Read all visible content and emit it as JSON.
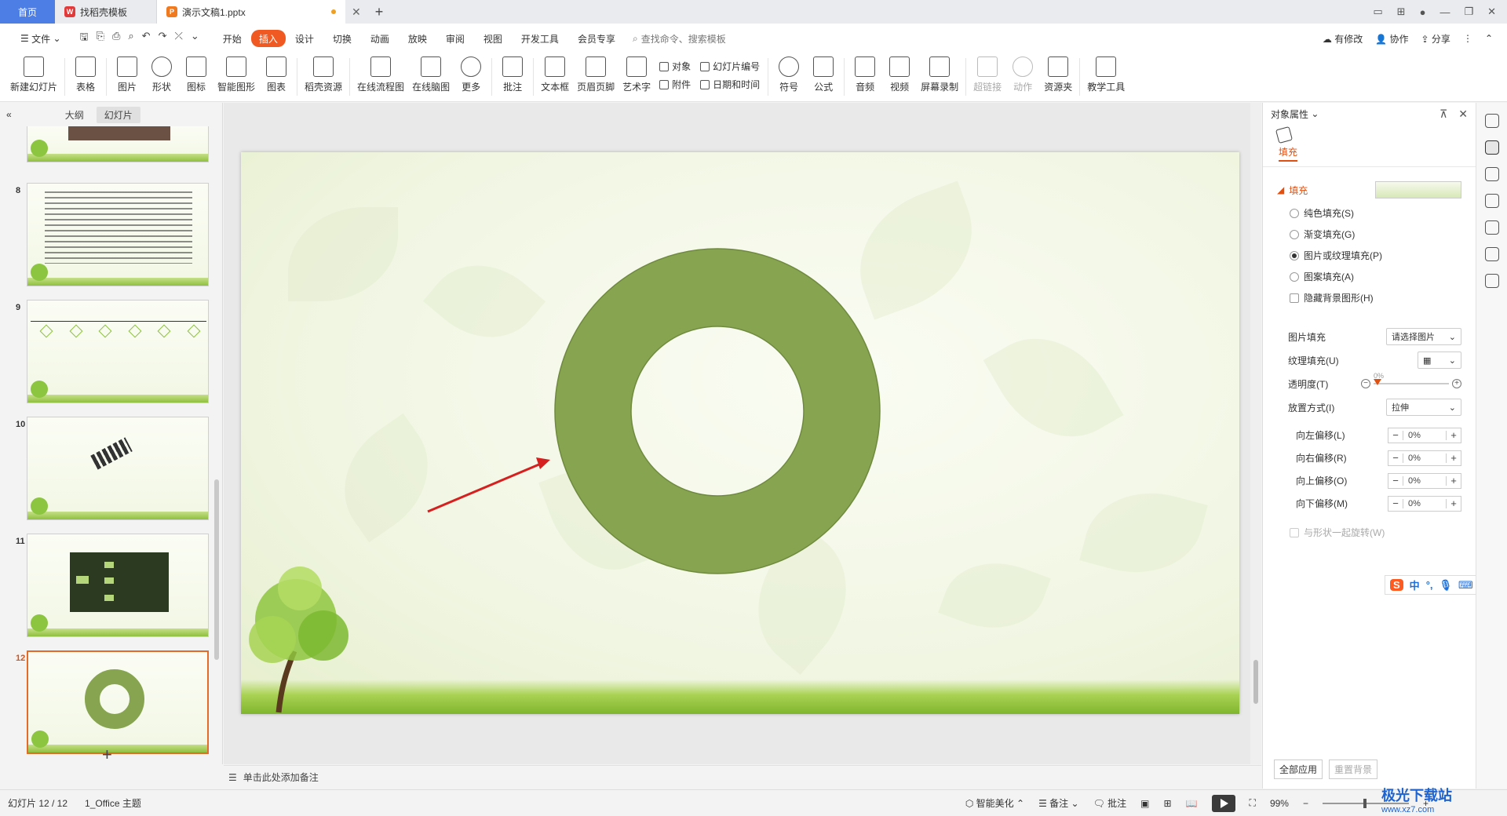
{
  "tabs": {
    "home": "首页",
    "template": "找稻壳模板",
    "doc": "演示文稿1.pptx"
  },
  "menu": {
    "file": "文件",
    "items": [
      "开始",
      "插入",
      "设计",
      "切换",
      "动画",
      "放映",
      "审阅",
      "视图",
      "开发工具",
      "会员专享"
    ],
    "active": "插入",
    "search": "查找命令、搜索模板",
    "modified": "有修改",
    "collab": "协作",
    "share": "分享"
  },
  "ribbon": {
    "new_slide": "新建幻灯片",
    "table": "表格",
    "picture": "图片",
    "shape": "形状",
    "icon": "图标",
    "smart": "智能图形",
    "chart": "图表",
    "resources": "稻壳资源",
    "flowchart": "在线流程图",
    "mindmap": "在线脑图",
    "more": "更多",
    "comment": "批注",
    "textbox": "文本框",
    "header_footer": "页眉页脚",
    "wordart": "艺术字",
    "object": "对象",
    "attachment": "附件",
    "slide_number": "幻灯片编号",
    "datetime": "日期和时间",
    "symbol": "符号",
    "formula": "公式",
    "audio": "音频",
    "video": "视频",
    "screen_record": "屏幕录制",
    "hyperlink": "超链接",
    "action": "动作",
    "resource_folder": "资源夹",
    "teaching": "教学工具"
  },
  "left_panel": {
    "tab_outline": "大纲",
    "tab_slides": "幻灯片",
    "thumbnails": [
      {
        "num": "8"
      },
      {
        "num": "9"
      },
      {
        "num": "10"
      },
      {
        "num": "11"
      },
      {
        "num": "12"
      }
    ],
    "selected": "12"
  },
  "notes_placeholder": "单击此处添加备注",
  "right_panel": {
    "title": "对象属性",
    "tab": "填充",
    "section": "填充",
    "options": [
      "纯色填充(S)",
      "渐变填充(G)",
      "图片或纹理填充(P)",
      "图案填充(A)"
    ],
    "selected_option": "图片或纹理填充(P)",
    "hide_bg": "隐藏背景图形(H)",
    "picture_fill_label": "图片填充",
    "picture_fill_value": "请选择图片",
    "texture_label": "纹理填充(U)",
    "transparency_label": "透明度(T)",
    "transparency_value": "0%",
    "placement_label": "放置方式(I)",
    "placement_value": "拉伸",
    "offsets": [
      {
        "label": "向左偏移(L)",
        "value": "0%"
      },
      {
        "label": "向右偏移(R)",
        "value": "0%"
      },
      {
        "label": "向上偏移(O)",
        "value": "0%"
      },
      {
        "label": "向下偏移(M)",
        "value": "0%"
      }
    ],
    "rotate_with_shape": "与形状一起旋转(W)",
    "apply_all": "全部应用",
    "reset_bg": "重置背景"
  },
  "status": {
    "slide": "幻灯片 12 / 12",
    "theme": "1_Office 主题",
    "beautify": "智能美化",
    "notes": "备注",
    "comments": "批注",
    "zoom": "99%"
  },
  "watermark": {
    "name": "极光下载站",
    "url": "www.xz7.com"
  },
  "colors": {
    "ring": "#87a450",
    "accent": "#e05010",
    "arrow": "#d62020"
  }
}
